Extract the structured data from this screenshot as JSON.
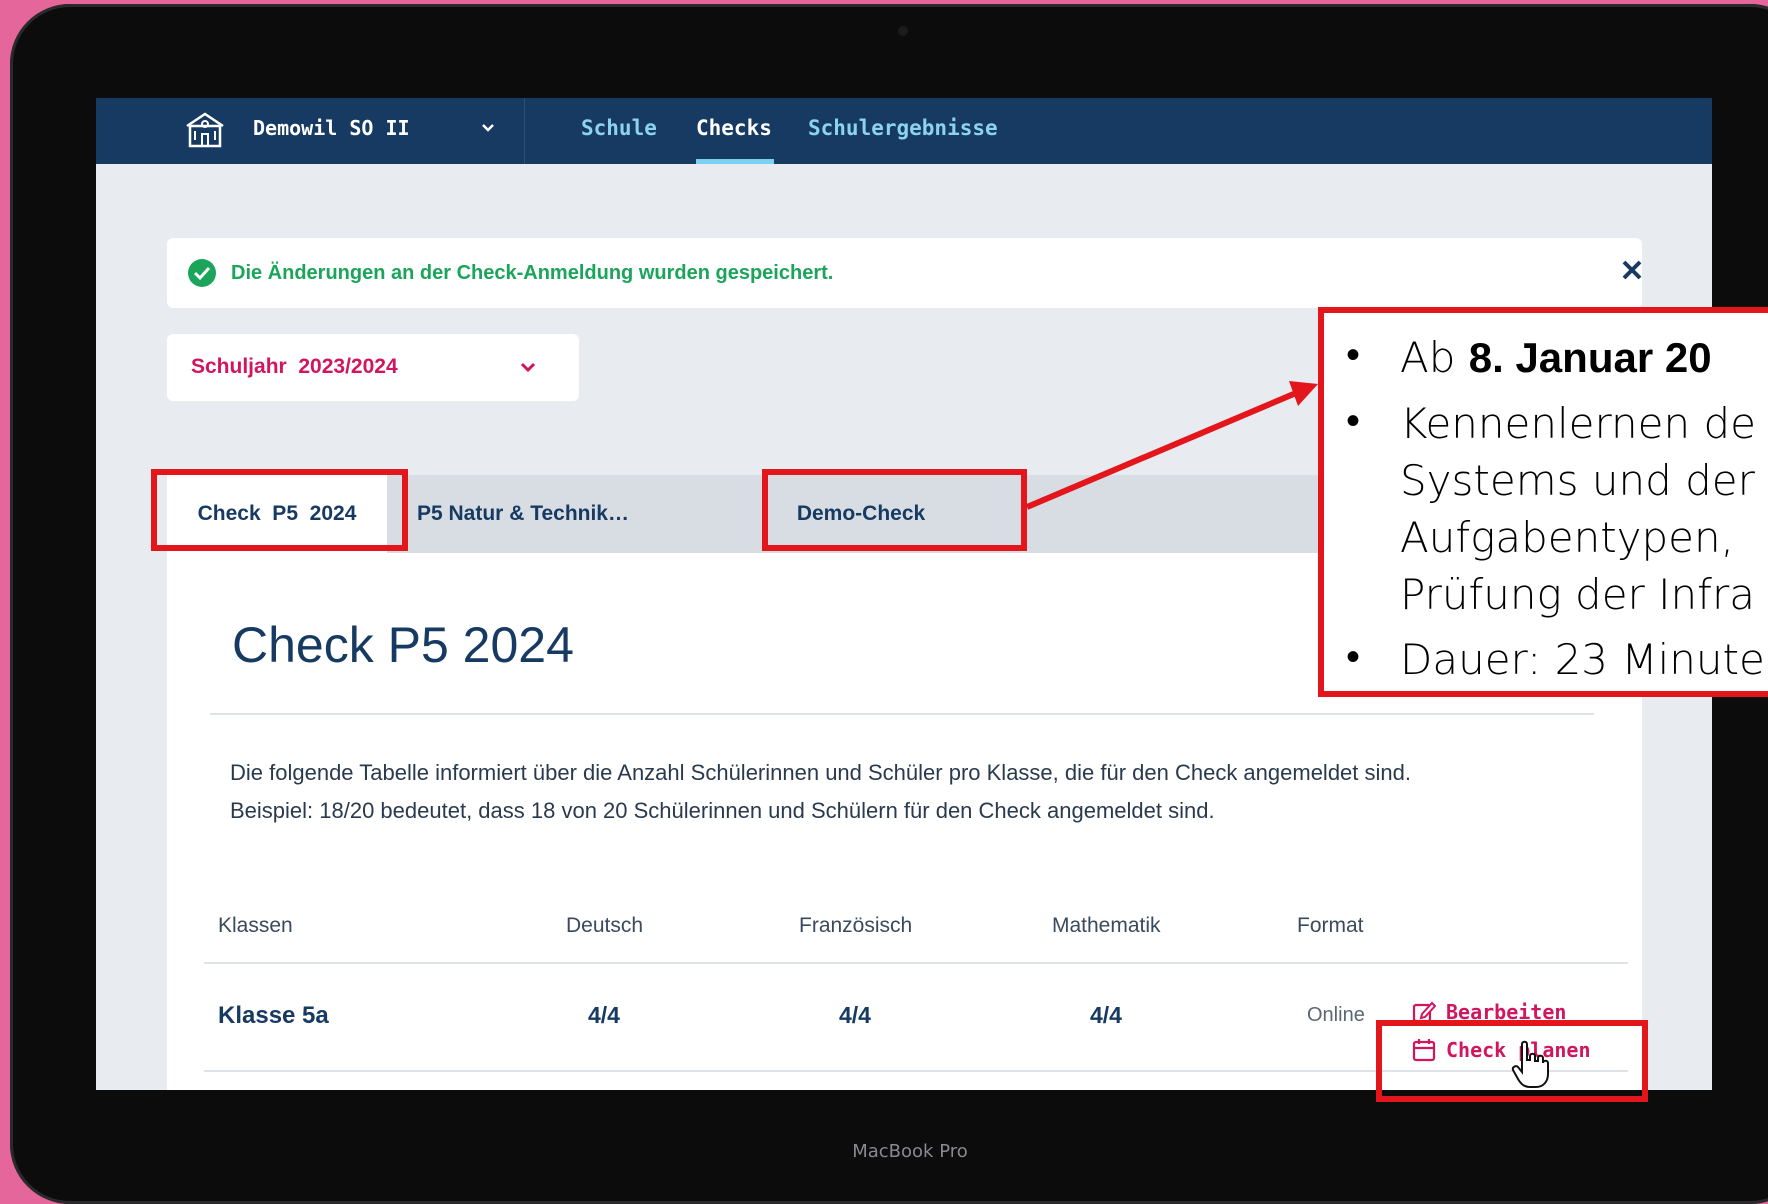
{
  "device": {
    "brand_label": "MacBook Pro"
  },
  "topnav": {
    "school_name": "Demowil SO II",
    "items": [
      {
        "label": "Schule",
        "active": false
      },
      {
        "label": "Checks",
        "active": true
      },
      {
        "label": "Schulergebnisse",
        "active": false
      }
    ]
  },
  "alert": {
    "message": "Die Änderungen an der Check-Anmeldung wurden gespeichert."
  },
  "year_select": {
    "label": "Schuljahr",
    "value": "2023/2024",
    "display": "Schuljahr  2023/2024"
  },
  "tabs": [
    {
      "label": "Check  P5  2024",
      "active": true
    },
    {
      "label": "P5 Natur & Technik…",
      "active": false
    },
    {
      "label": "Demo-Check",
      "active": false
    }
  ],
  "content": {
    "title": "Check P5 2024",
    "description_line1": "Die folgende Tabelle informiert über die Anzahl Schülerinnen und Schüler pro Klasse, die für den Check angemeldet sind.",
    "description_line2": "Beispiel: 18/20 bedeutet, dass 18 von 20 Schülerinnen und Schülern für den Check angemeldet sind."
  },
  "table": {
    "headers": [
      "Klassen",
      "Deutsch",
      "Französisch",
      "Mathematik",
      "Format"
    ],
    "rows": [
      {
        "klasse": "Klasse 5a",
        "deutsch": "4/4",
        "franzoesisch": "4/4",
        "mathematik": "4/4",
        "format": "Online"
      }
    ],
    "actions": {
      "edit": "Bearbeiten",
      "plan": "Check planen"
    }
  },
  "callout": {
    "line1_prefix": "Ab ",
    "line1_bold": "8. Januar 20",
    "line2": "Kennenlernen de",
    "line3": "Systems und der",
    "line4": "Aufgabentypen,",
    "line5": "Prüfung der Infra",
    "line6": "Dauer: 23 Minute"
  },
  "colors": {
    "accent_pink": "#d2155f",
    "nav_bg": "#173a62",
    "success": "#1aa55a",
    "highlight_red": "#e3161b",
    "background": "#e4669a"
  }
}
